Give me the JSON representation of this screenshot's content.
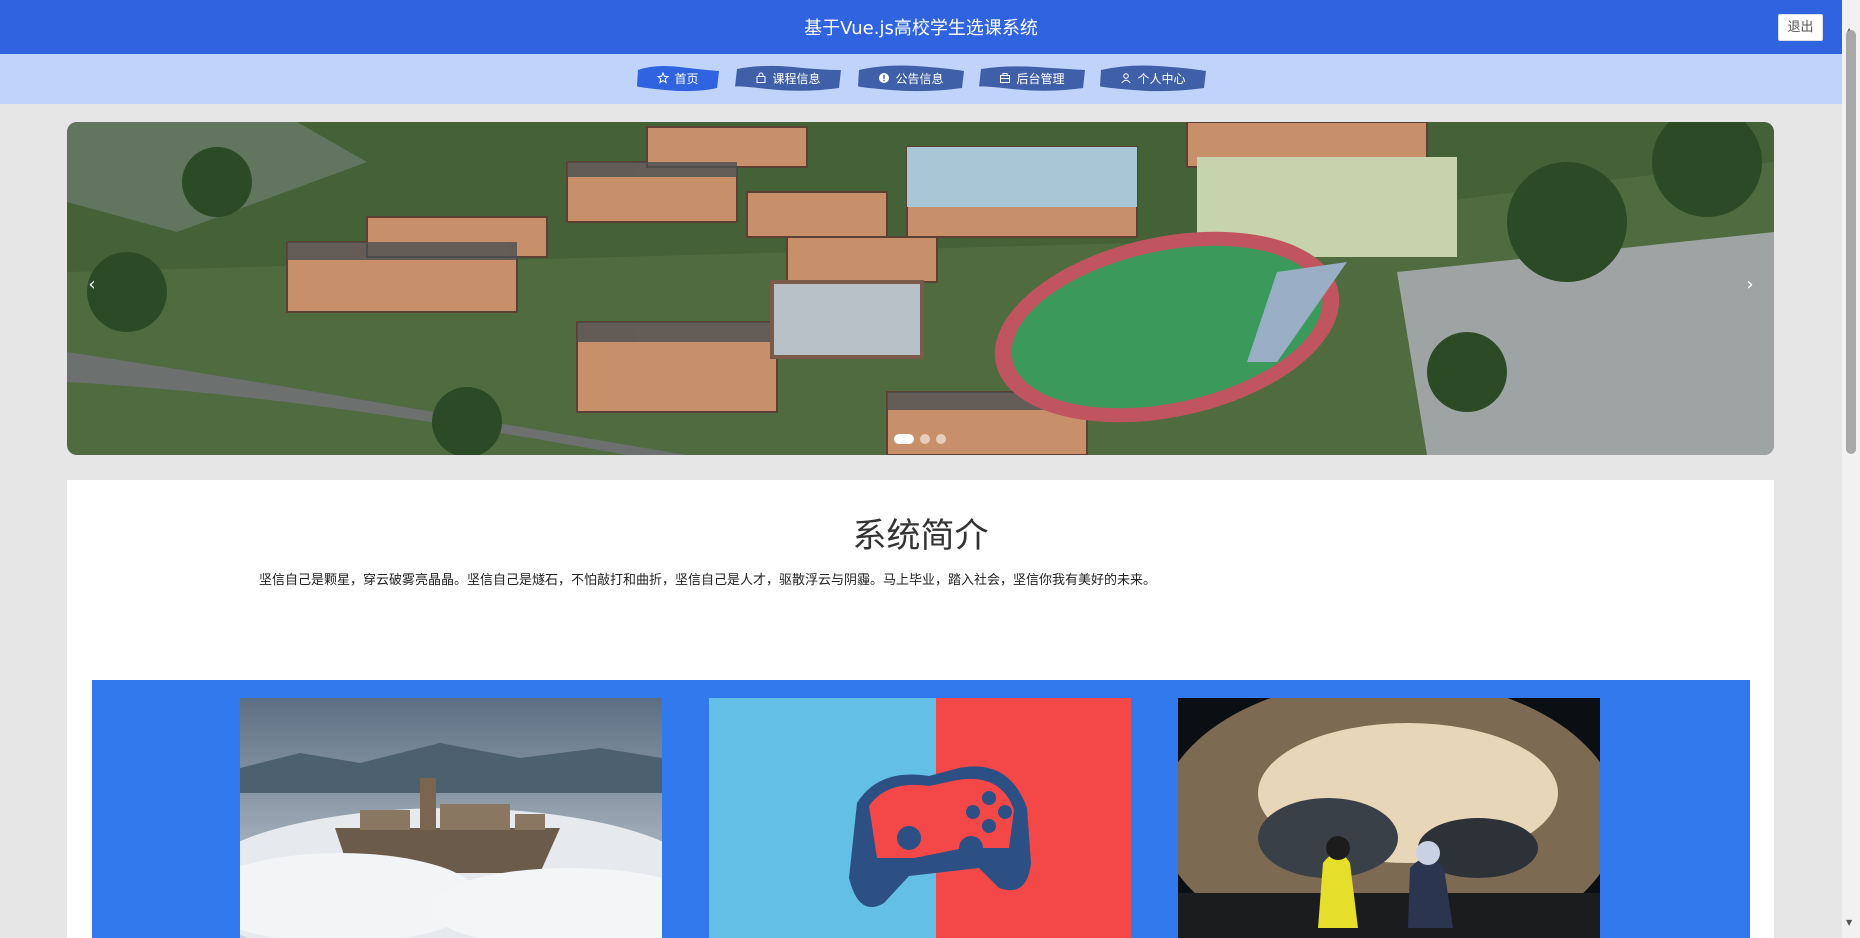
{
  "header": {
    "title": "基于Vue.js高校学生选课系统",
    "logout_label": "退出"
  },
  "nav": {
    "items": [
      {
        "label": "首页",
        "icon": "star-icon"
      },
      {
        "label": "课程信息",
        "icon": "bag-icon"
      },
      {
        "label": "公告信息",
        "icon": "info-icon"
      },
      {
        "label": "后台管理",
        "icon": "briefcase-icon"
      },
      {
        "label": "个人中心",
        "icon": "user-icon"
      }
    ],
    "active_index": 0
  },
  "carousel": {
    "prev_glyph": "‹",
    "next_glyph": "›",
    "slide_count": 3,
    "active_slide": 0
  },
  "intro": {
    "title": "系统简介",
    "text": "坚信自己是颗星，穿云破雾亮晶晶。坚信自己是燧石，不怕敲打和曲折，坚信自己是人才，驱散浮云与阴霾。马上毕业，踏入社会，坚信你我有美好的未来。"
  },
  "colors": {
    "header_bg": "#2f63e0",
    "nav_bg": "#c0d3fb",
    "nav_active": "#2f63e0",
    "nav_item": "#3f5fa8",
    "feature_bg": "#3279ed"
  }
}
